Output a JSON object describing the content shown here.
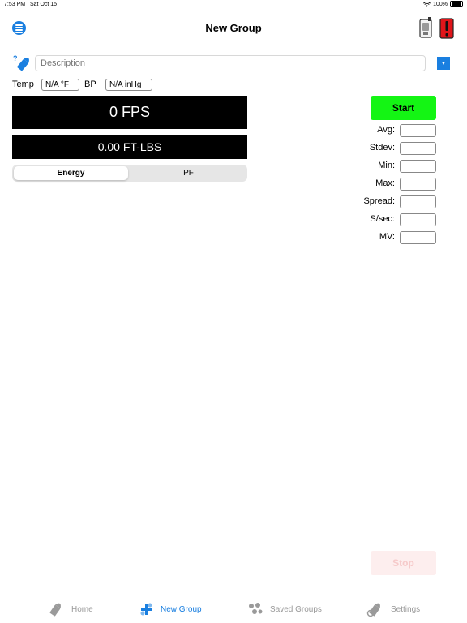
{
  "status_bar": {
    "time": "7:53 PM",
    "date": "Sat Oct 15",
    "battery": "100%"
  },
  "nav": {
    "title": "New Group",
    "menu_icon": "list-icon",
    "chrono_icon": "chronograph-icon",
    "alert_icon": "warning-icon"
  },
  "description": {
    "placeholder": "Description",
    "value": "",
    "icon": "bullet-help-icon"
  },
  "conditions": {
    "temp_label": "Temp",
    "temp_value": "N/A °F",
    "bp_label": "BP",
    "bp_value": "N/A inHg"
  },
  "display": {
    "velocity": "0 FPS",
    "energy": "0.00 FT-LBS"
  },
  "segment": {
    "options": [
      "Energy",
      "PF"
    ],
    "selected": "Energy"
  },
  "start_label": "Start",
  "stop_label": "Stop",
  "stats": [
    {
      "label": "Avg:",
      "value": ""
    },
    {
      "label": "Stdev:",
      "value": ""
    },
    {
      "label": "Min:",
      "value": ""
    },
    {
      "label": "Max:",
      "value": ""
    },
    {
      "label": "Spread:",
      "value": ""
    },
    {
      "label": "S/sec:",
      "value": ""
    },
    {
      "label": "MV:",
      "value": ""
    }
  ],
  "tabs": [
    {
      "label": "Home",
      "icon": "bullet-icon"
    },
    {
      "label": "New Group",
      "icon": "new-group-icon"
    },
    {
      "label": "Saved Groups",
      "icon": "saved-groups-icon"
    },
    {
      "label": "Settings",
      "icon": "settings-bullet-icon"
    }
  ],
  "colors": {
    "accent": "#1a7fe0",
    "start": "#14f514",
    "stop_disabled": "#fdeeee",
    "alert": "#e0151a"
  }
}
